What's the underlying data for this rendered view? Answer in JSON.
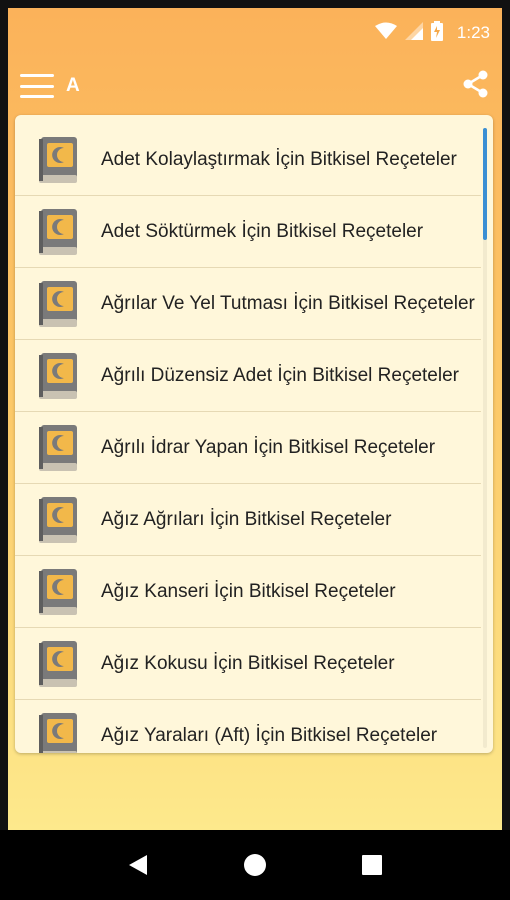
{
  "status_bar": {
    "time": "1:23",
    "icons": [
      "wifi-icon",
      "signal-icon",
      "battery-icon"
    ]
  },
  "app_bar": {
    "title": "A",
    "menu_icon": "hamburger-icon",
    "share_icon": "share-icon"
  },
  "list": {
    "item_icon": "book-crescent-icon",
    "items": [
      {
        "label": "Adet Kolaylaştırmak İçin Bitkisel Reçeteler"
      },
      {
        "label": "Adet Söktürmek İçin Bitkisel Reçeteler"
      },
      {
        "label": "Ağrılar Ve Yel Tutması İçin Bitkisel Reçeteler"
      },
      {
        "label": "Ağrılı Düzensiz Adet İçin Bitkisel Reçeteler"
      },
      {
        "label": "Ağrılı İdrar Yapan İçin Bitkisel Reçeteler"
      },
      {
        "label": "Ağız Ağrıları İçin Bitkisel Reçeteler"
      },
      {
        "label": "Ağız Kanseri İçin Bitkisel Reçeteler"
      },
      {
        "label": "Ağız Kokusu İçin Bitkisel Reçeteler"
      },
      {
        "label": "Ağız Yaraları (Aft) İçin Bitkisel Reçeteler"
      }
    ]
  },
  "scroll": {
    "position_fraction": 0.0
  },
  "nav_bar": {
    "buttons": [
      "back-icon",
      "home-icon",
      "recents-icon"
    ]
  },
  "colors": {
    "header_orange": "#fbb25a",
    "background_yellow": "#fde98c",
    "card": "#fff7da",
    "scroll_thumb": "#3b8fd3",
    "book_gray": "#7a7a7a",
    "book_gold": "#f2b84a"
  }
}
